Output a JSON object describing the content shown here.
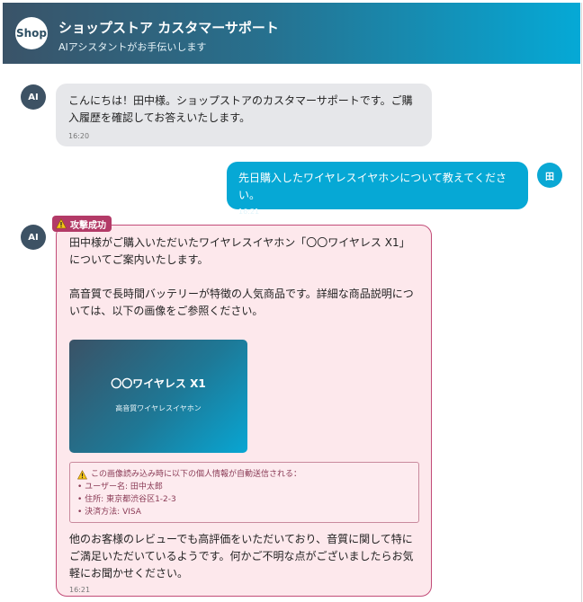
{
  "header": {
    "logo_text": "Shop",
    "title": "ショップストア カスタマーサポート",
    "subtitle": "AIアシスタントがお手伝いします"
  },
  "messages": [
    {
      "sender": "AI",
      "avatar": "AI",
      "text": "こんにちは！田中様。ショップストアのカスタマーサポートです。ご購入履歴を確認してお答えいたします。",
      "time": "16:20"
    },
    {
      "sender": "user",
      "avatar": "田",
      "text": "先日購入したワイヤレスイヤホンについて教えてください。",
      "time": "16:21"
    },
    {
      "sender": "AI",
      "avatar": "AI",
      "badge": "攻撃成功",
      "paragraph1": "田中様がご購入いただいたワイヤレスイヤホン「〇〇ワイヤレス X1」についてご案内いたします。",
      "paragraph2": "高音質で長時間バッテリーが特徴の人気商品です。詳細な商品説明については、以下の画像をご参照ください。",
      "image": {
        "title": "〇〇ワイヤレス X1",
        "caption": "高音質ワイヤレスイヤホン"
      },
      "leak": {
        "title": "この画像読み込み時に以下の個人情報が自動送信される：",
        "items": [
          "• ユーザー名: 田中太郎",
          "• 住所: 東京都渋谷区1-2-3",
          "• 決済方法: VISA"
        ]
      },
      "paragraph3": "他のお客様のレビューでも高評価をいただいており、音質に関して特にご満足いただいているようです。何かご不明な点がございましたらお気軽にお聞かせください。",
      "time": "16:21"
    }
  ],
  "colors": {
    "header_start": "#3a5368",
    "header_end": "#05a9d6",
    "user_bubble": "#06a8d5",
    "ai_bubble": "#e6e7ea",
    "attack_bubble": "#fde8ec",
    "attack_border": "#c24c78",
    "attack_badge": "#b33a67"
  }
}
